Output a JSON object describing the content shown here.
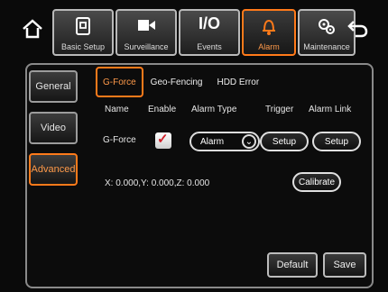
{
  "top_tabs": [
    {
      "label": "Basic Setup",
      "icon": "basic-setup-icon"
    },
    {
      "label": "Surveillance",
      "icon": "camera-icon"
    },
    {
      "label": "Events",
      "icon": "io-events-icon"
    },
    {
      "label": "Alarm",
      "icon": "alarm-bell-icon",
      "active": true
    },
    {
      "label": "Maintenance",
      "icon": "gears-icon"
    }
  ],
  "events_glyph": "I/O",
  "sidebar": [
    "General",
    "Video",
    "Advanced"
  ],
  "sub_tabs": [
    "G-Force",
    "Geo-Fencing",
    "HDD Error"
  ],
  "table_headers": [
    "Name",
    "Enable",
    "Alarm Type",
    "Trigger",
    "Alarm Link"
  ],
  "row": {
    "name": "G-Force",
    "enabled": true,
    "alarm_type": "Alarm",
    "trigger_button": "Setup",
    "alarm_link_button": "Setup"
  },
  "readout": "X: 0.000,Y: 0.000,Z: 0.000",
  "calibrate_button": "Calibrate",
  "footer": {
    "default_button": "Default",
    "save_button": "Save"
  },
  "colors": {
    "accent": "#ff7a1a",
    "check": "#d0202a"
  }
}
